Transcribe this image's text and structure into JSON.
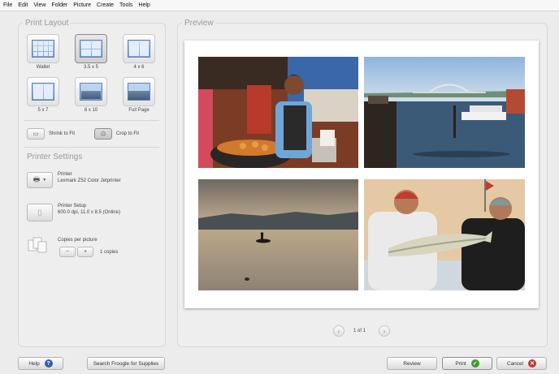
{
  "menu": [
    "File",
    "Edit",
    "View",
    "Folder",
    "Picture",
    "Create",
    "Tools",
    "Help"
  ],
  "left_panel": {
    "title": "Print Layout",
    "layouts": [
      {
        "label": "Wallet",
        "selected": false
      },
      {
        "label": "3.5 x 5",
        "selected": true
      },
      {
        "label": "4 x 6",
        "selected": false
      },
      {
        "label": "5 x 7",
        "selected": false
      },
      {
        "label": "8 x 10",
        "selected": false
      },
      {
        "label": "Full Page",
        "selected": false
      }
    ],
    "shrink_to_fit": "Shrink to Fit",
    "crop_to_fit": "Crop to Fit",
    "printer_settings_title": "Printer Settings",
    "printer_label": "Printer",
    "printer_name": "Lexmark Z52 Color Jetprinter",
    "printer_setup_label": "Printer Setup",
    "printer_setup_value": "600.0 dpi, 11.0 x 8.5 (Online)",
    "copies_label": "Copies per picture",
    "copies_minus": "−",
    "copies_plus": "+",
    "copies_value": "1 copies"
  },
  "preview": {
    "title": "Preview",
    "page_indicator": "1 of 1",
    "photos": [
      "market-vendor-photo",
      "harbor-bridge-photo",
      "lake-sunset-fisherman-photo",
      "two-fishermen-photo"
    ]
  },
  "footer": {
    "help": "Help",
    "froogle": "Search Froogle for Supplies",
    "review": "Review",
    "print": "Print",
    "cancel": "Cancel"
  },
  "colors": {
    "print_icon": "#3e9a2a",
    "cancel_icon": "#c83232",
    "help_icon": "#2e5fb3"
  }
}
